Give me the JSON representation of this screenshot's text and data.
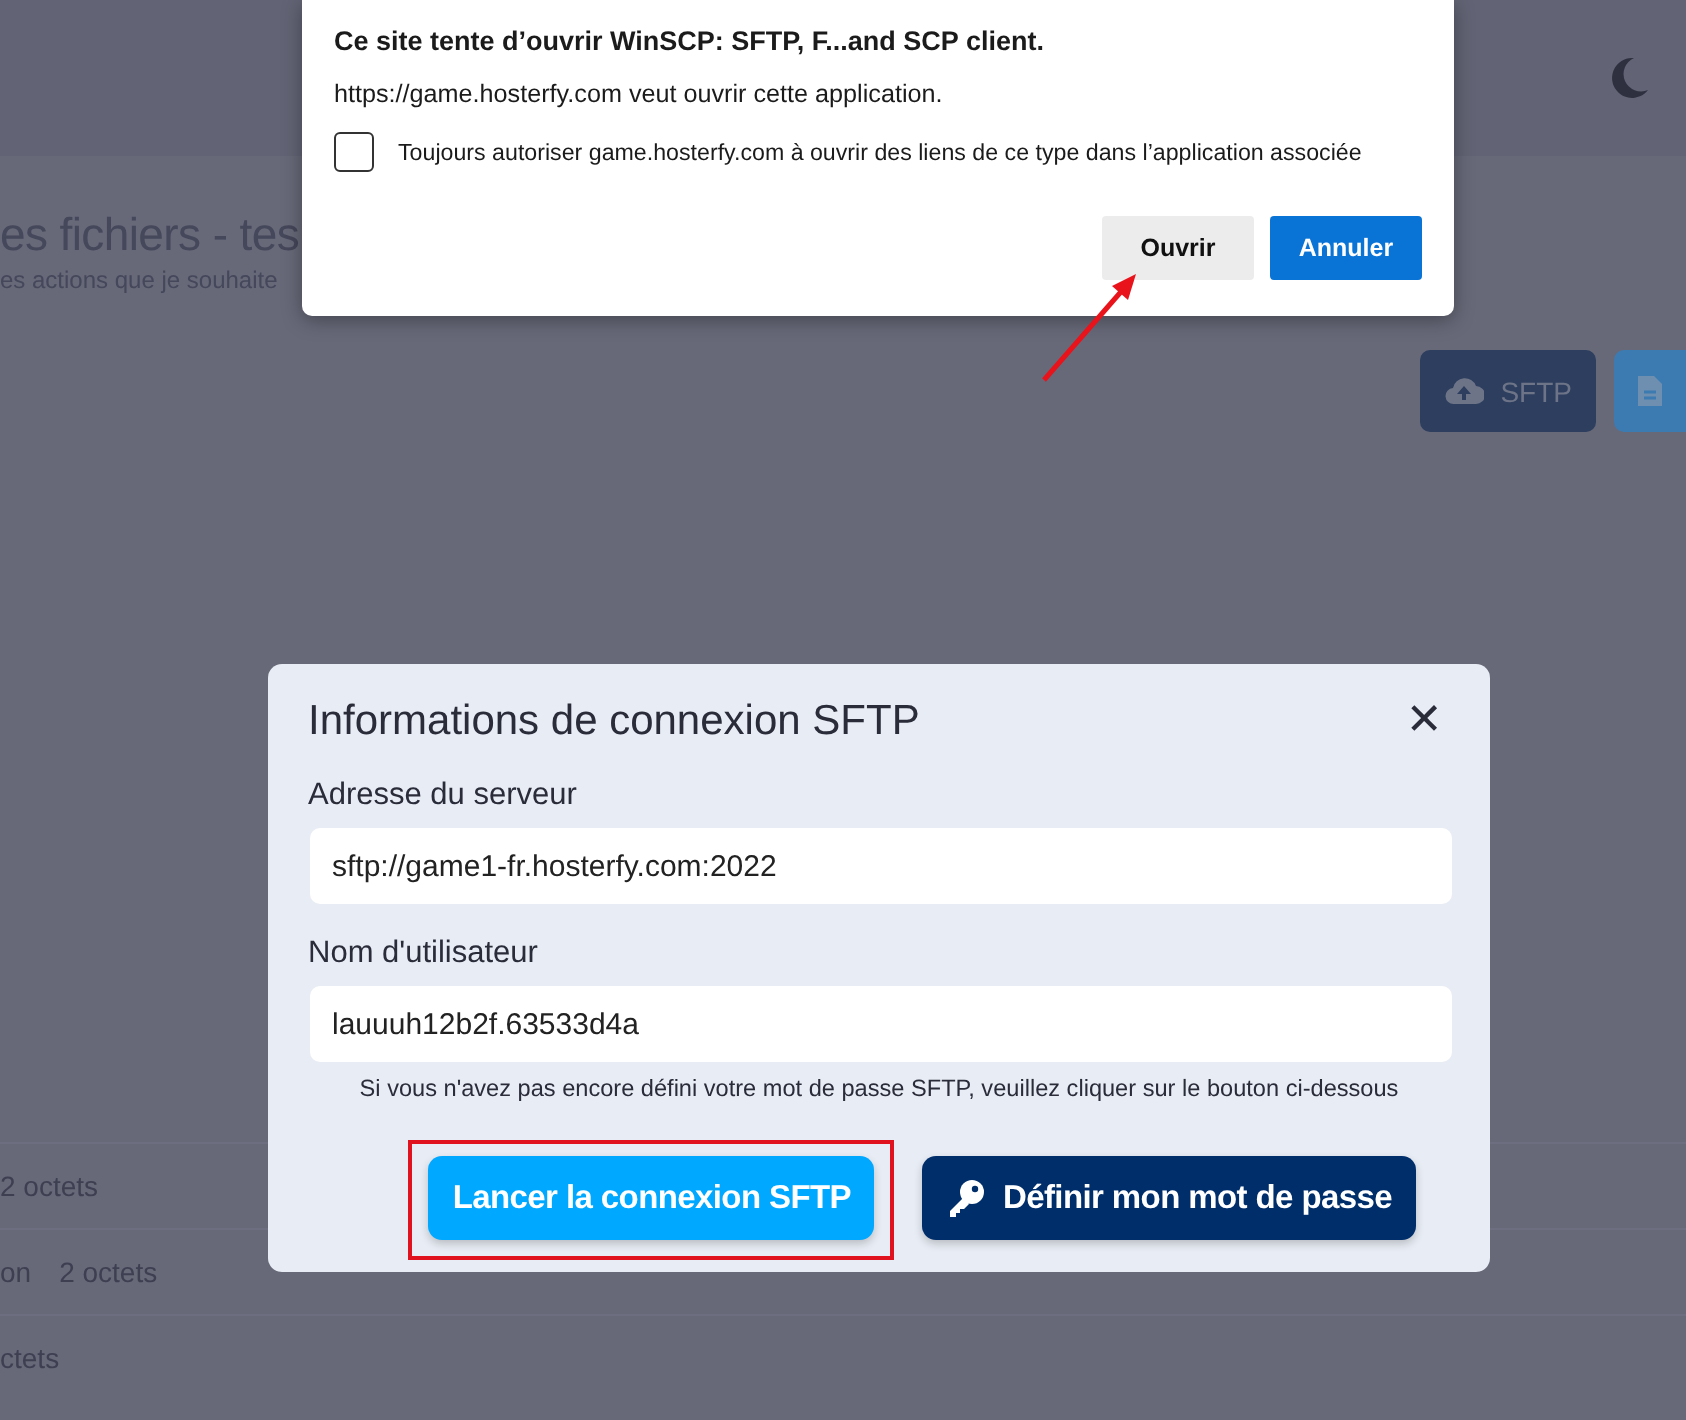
{
  "background_page": {
    "title": "es fichiers - tes",
    "subtitle": "es actions que je souhaite",
    "toolbar_buttons": [
      {
        "label": "SFTP",
        "kind": "sftp"
      },
      {
        "kind": "file"
      }
    ],
    "rows": [
      {
        "cells": [
          "2 octets"
        ]
      },
      {
        "cells": [
          "on",
          "2 octets"
        ]
      },
      {
        "cells": [
          "ctets"
        ]
      }
    ]
  },
  "browser_prompt": {
    "title": "Ce site tente d’ouvrir WinSCP: SFTP, F...and SCP client.",
    "message": "https://game.hosterfy.com veut ouvrir cette application.",
    "checkbox": {
      "label": "Toujours autoriser game.hosterfy.com à ouvrir des liens de ce type dans l’application associée",
      "checked": false
    },
    "buttons": [
      {
        "label": "Ouvrir",
        "kind": "secondary"
      },
      {
        "label": "Annuler",
        "kind": "primary"
      }
    ]
  },
  "sftp_modal": {
    "title": "Informations de connexion SFTP",
    "close": "✕",
    "fields": [
      {
        "label": "Adresse du serveur",
        "value": "sftp://game1-fr.hosterfy.com:2022"
      },
      {
        "label": "Nom d'utilisateur",
        "value": "lauuuh12b2f.63533d4a"
      }
    ],
    "note": "Si vous n'avez pas encore défini votre mot de passe SFTP, veuillez cliquer sur le bouton ci-dessous",
    "buttons": [
      {
        "label": "Lancer la connexion SFTP",
        "kind": "launch",
        "highlighted": true
      },
      {
        "label": "Définir mon mot de passe",
        "kind": "password",
        "highlighted": false
      }
    ]
  }
}
